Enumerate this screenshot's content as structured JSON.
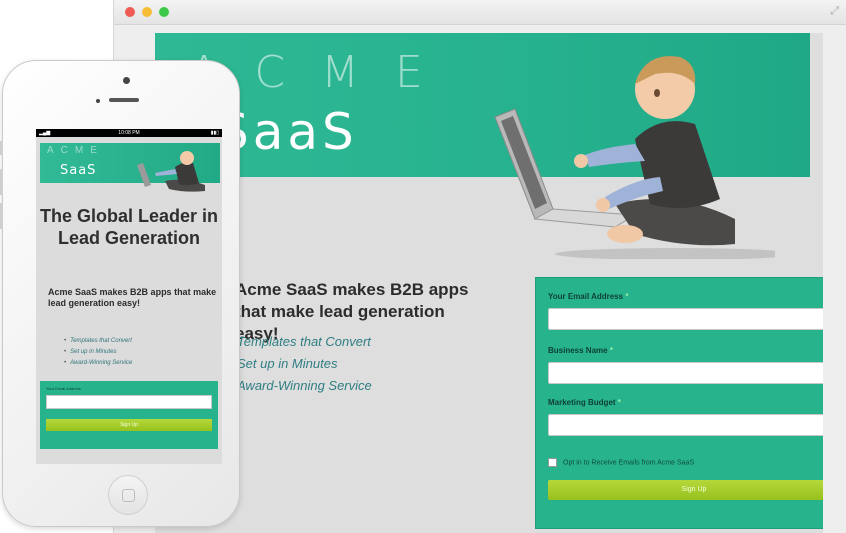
{
  "desktop": {
    "hero": {
      "logo_top": "ACME",
      "logo_main": "SaaS"
    },
    "headline": "Acme SaaS makes B2B apps that make lead generation easy!",
    "features": [
      "Templates that Convert",
      "Set up in Minutes",
      "Award-Winning Service"
    ],
    "form": {
      "email_label": "Your Email Address",
      "business_label": "Business Name",
      "budget_label": "Marketing Budget",
      "required_mark": "*",
      "optin_text": "Opt in to Receive Emails from Acme SaaS",
      "signup_label": "Sign Up"
    }
  },
  "mobile": {
    "status": {
      "time": "10:08 PM",
      "signal": "▂▄▆",
      "battery": "▮▮▯"
    },
    "hero": {
      "logo_top": "ACME",
      "logo_main": "SaaS"
    },
    "title": "The Global Leader in Lead Generation",
    "subtitle": "Acme SaaS makes B2B apps that make lead generation easy!",
    "features": [
      "Templates that Convert",
      "Set up in Minutes",
      "Award-Winning Service"
    ],
    "form": {
      "email_label": "Your Email Address",
      "signup_label": "Sign Up"
    }
  },
  "colors": {
    "brand_green": "#27b48d",
    "button_lime": "#a8cf2c",
    "feature_teal": "#2f7e83"
  },
  "icons": {
    "close": "close-dot-icon",
    "minimize": "minimize-dot-icon",
    "zoom": "zoom-dot-icon",
    "expand": "expand-icon",
    "select_arrow": "chevron-down-icon",
    "home": "home-button-icon"
  }
}
